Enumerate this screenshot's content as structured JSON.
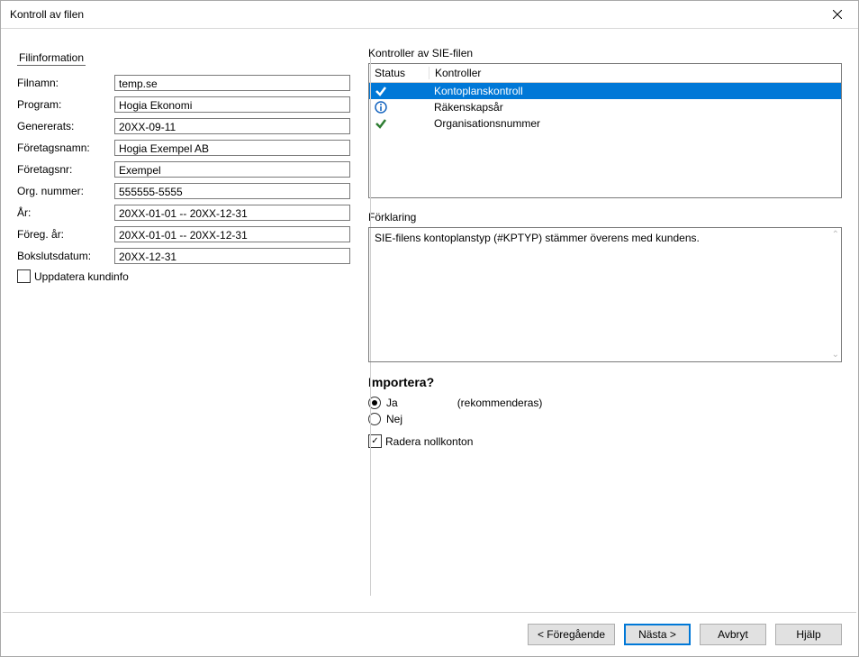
{
  "window": {
    "title": "Kontroll av filen"
  },
  "left": {
    "section_header": "Filinformation",
    "rows": [
      {
        "label": "Filnamn:",
        "value": "temp.se"
      },
      {
        "label": "Program:",
        "value": "Hogia Ekonomi"
      },
      {
        "label": "Genererats:",
        "value": "20XX-09-11"
      },
      {
        "label": "Företagsnamn:",
        "value": "Hogia Exempel AB"
      },
      {
        "label": "Företagsnr:",
        "value": "Exempel"
      },
      {
        "label": "Org. nummer:",
        "value": "555555-5555"
      },
      {
        "label": "År:",
        "value": "20XX-01-01 -- 20XX-12-31"
      },
      {
        "label": "Föreg. år:",
        "value": "20XX-01-01 -- 20XX-12-31"
      },
      {
        "label": "Bokslutsdatum:",
        "value": "20XX-12-31"
      }
    ],
    "update_checkbox": {
      "label": "Uppdatera kundinfo",
      "checked": false
    }
  },
  "right": {
    "controls_label": "Kontroller av SIE-filen",
    "columns": {
      "status": "Status",
      "name": "Kontroller"
    },
    "rows": [
      {
        "icon": "check",
        "name": "Kontoplanskontroll",
        "selected": true
      },
      {
        "icon": "info",
        "name": "Räkenskapsår",
        "selected": false
      },
      {
        "icon": "check",
        "name": "Organisationsnummer",
        "selected": false
      }
    ],
    "explain_label": "Förklaring",
    "explain_text": "SIE-filens kontoplanstyp (#KPTYP) stämmer överens med kundens.",
    "import": {
      "heading": "Importera?",
      "yes_label": "Ja",
      "no_label": "Nej",
      "recommended": "(rekommenderas)",
      "selected": "yes",
      "delete_label": "Radera nollkonton",
      "delete_checked": true
    }
  },
  "footer": {
    "prev": "< Föregående",
    "next": "Nästa >",
    "cancel": "Avbryt",
    "help": "Hjälp"
  }
}
